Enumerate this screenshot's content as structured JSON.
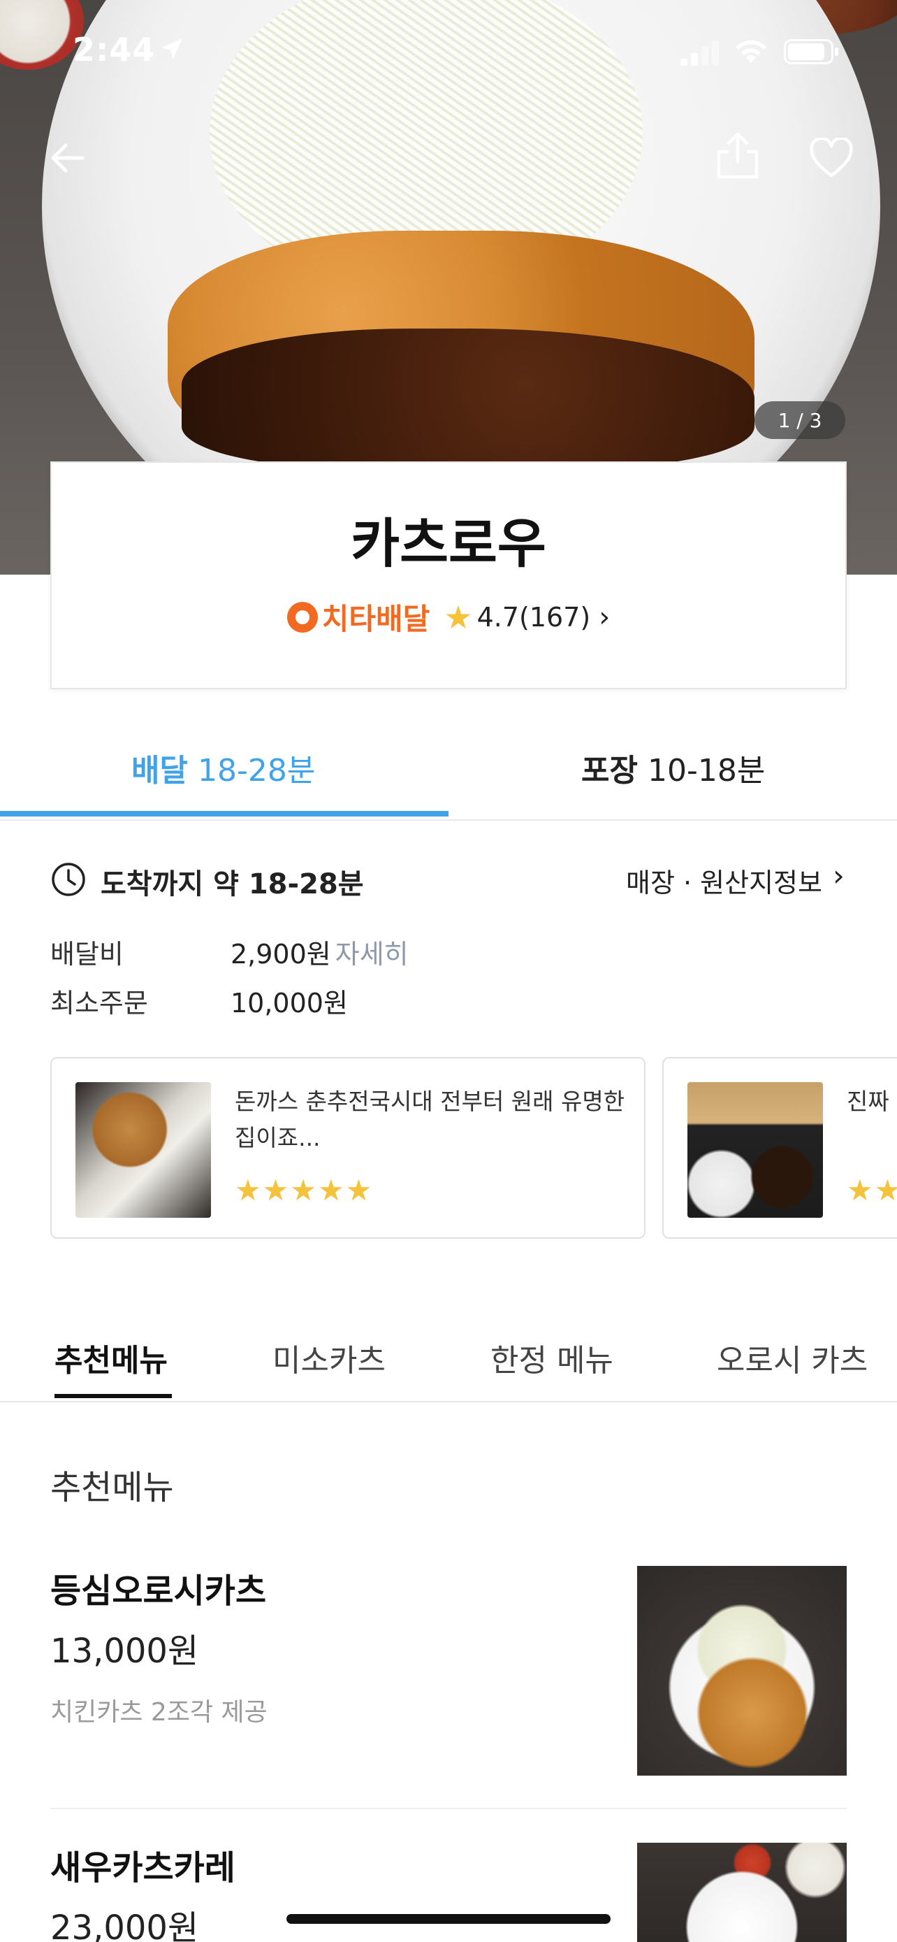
{
  "status_bar": {
    "time": "2:44"
  },
  "hero": {
    "image_counter": "1 / 3"
  },
  "store": {
    "name": "카츠로우",
    "badge": "치타배달",
    "rating": "4.7(167)",
    "rating_chevron": "›"
  },
  "delivery_tabs": [
    {
      "label": "배달",
      "time": "18-28분",
      "active": true
    },
    {
      "label": "포장",
      "time": "10-18분",
      "active": false
    }
  ],
  "info": {
    "arrival": "도착까지 약 18-28분",
    "store_info_link": "매장 · 원산지정보",
    "delivery_fee_label": "배달비",
    "delivery_fee_value": "2,900원",
    "delivery_fee_detail": "자세히",
    "min_order_label": "최소주문",
    "min_order_value": "10,000원"
  },
  "reviews": [
    {
      "text": "돈까스 춘추전국시대 전부터 원래 유명한 집이죠...",
      "stars": "★★★★★"
    },
    {
      "text": "진짜",
      "stars": "★★"
    }
  ],
  "category_tabs": [
    "추천메뉴",
    "미소카츠",
    "한정 메뉴",
    "오로시 카츠"
  ],
  "section_title": "추천메뉴",
  "menu_items": [
    {
      "name": "등심오로시카츠",
      "price": "13,000원",
      "description": "치킨카츠 2조각 제공"
    },
    {
      "name": "새우카츠카레",
      "price": "23,000원",
      "description": ""
    }
  ],
  "colors": {
    "accent": "#3ea3e8",
    "cheetah": "#f26a21",
    "star": "#f5c33b"
  }
}
